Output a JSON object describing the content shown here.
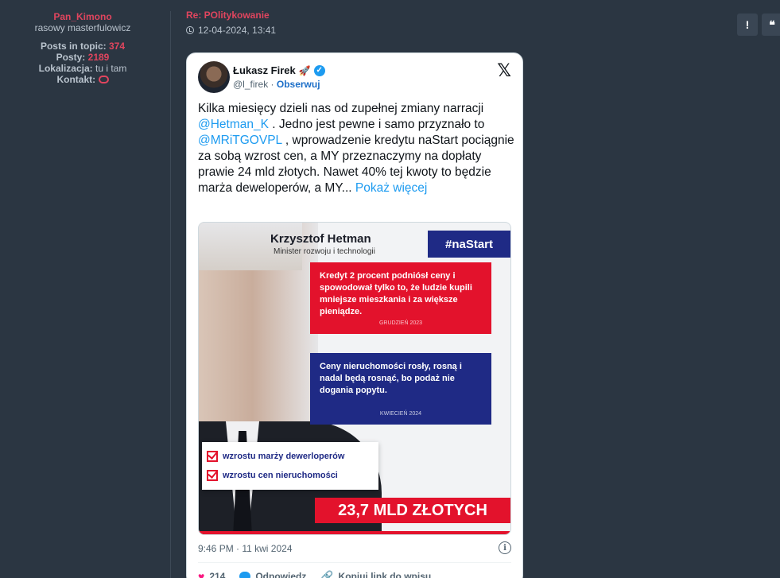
{
  "profile": {
    "username": "Pan_Kimono",
    "rank": "rasowy masterfulowicz",
    "posts_in_topic_label": "Posts in topic:",
    "posts_in_topic_value": "374",
    "posts_label": "Posty:",
    "posts_value": "2189",
    "location_label": "Lokalizacja:",
    "location_value": "tu i tam",
    "contact_label": "Kontakt:"
  },
  "post": {
    "title": "Re: POlitykowanie",
    "date": "12-04-2024, 13:41",
    "report_label": "!",
    "quote_label": "❝"
  },
  "tweet": {
    "author": "Łukasz Firek",
    "handle": "@l_firek",
    "separator": " · ",
    "follow": "Obserwuj",
    "x_logo": "𝕏",
    "text_1": "Kilka miesięcy dzieli nas od zupełnej zmiany narracji ",
    "mention_1": "@Hetman_K",
    "text_2": " . Jedno jest pewne i samo przyznało to ",
    "mention_2": "@MRiTGOVPL",
    "text_3": " , wprowadzenie kredytu naStart pociągnie za sobą wzrost cen, a MY przeznaczymy na dopłaty prawie 24 mld złotych. Nawet 40% tej kwoty to będzie marża deweloperów, a MY... ",
    "show_more": "Pokaż więcej",
    "time": "9:46 PM · 11 kwi 2024",
    "likes": "214",
    "reply": "Odpowiedz",
    "copy_link": "Kopiuj link do wpisu"
  },
  "media": {
    "name": "Krzysztof Hetman",
    "role": "Minister rozwoju i technologii",
    "tag": "#naStart",
    "quote_red": "Kredyt 2 procent podniósł ceny i spowodował tylko to, że ludzie kupili mniejsze mieszkania i za większe pieniądze.",
    "quote_red_date": "GRUDZIEŃ 2023",
    "quote_blue": "Ceny nieruchomości rosły, rosną i nadal będą rosnąć, bo podaż nie dogania popytu.",
    "quote_blue_date": "KWIECIEŃ 2024",
    "check_1": "wzrostu marży dewerloperów",
    "check_2": "wzrostu cen nieruchomości",
    "total": "23,7 MLD ZŁOTYCH"
  }
}
